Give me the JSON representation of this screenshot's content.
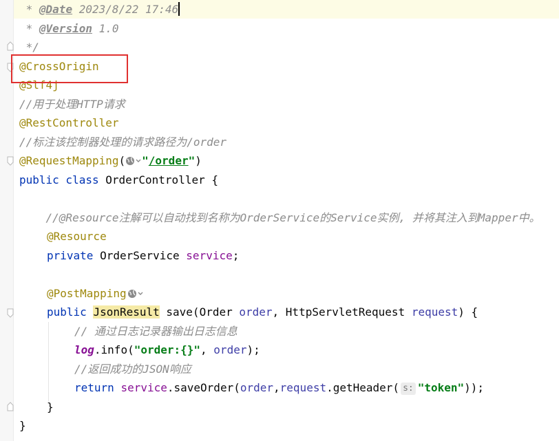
{
  "code": {
    "l1_prefix": " * ",
    "l1_tag": "@Date",
    "l1_rest": " 2023/8/22 17:46",
    "l2_prefix": " * ",
    "l2_tag": "@Version",
    "l2_rest": " 1.0",
    "l3": " */",
    "l4": "@CrossOrigin",
    "l5": "@Slf4j",
    "l6": "//用于处理HTTP请求",
    "l7": "@RestController",
    "l8": "//标注该控制器处理的请求路径为/order",
    "l9_ann": "@RequestMapping",
    "l9_open": "(",
    "l9_str_q1": "\"",
    "l9_str_path": "/order",
    "l9_str_q2": "\"",
    "l9_close": ")",
    "l10_kw": "public class",
    "l10_rest": " OrderController {",
    "l12": "    //@Resource注解可以自动找到名称为OrderService的Service实例, 并将其注入到Mapper中。",
    "l13": "@Resource",
    "l14_kw": "private",
    "l14_type": " OrderService ",
    "l14_field": "service",
    "l14_end": ";",
    "l16": "@PostMapping",
    "l17_kw": "public",
    "l17_ret": "JsonResult",
    "l17_a": " save(Order ",
    "l17_p1": "order",
    "l17_b": ", HttpServletRequest ",
    "l17_p2": "request",
    "l17_c": ") {",
    "l18": "// 通过日志记录器输出日志信息",
    "l19_log": "log",
    "l19_a": ".info(",
    "l19_str": "\"order:{}\"",
    "l19_b": ", ",
    "l19_p": "order",
    "l19_c": ");",
    "l20": "//返回成功的JSON响应",
    "l21_kw": "return",
    "l21_field": "service",
    "l21_a": ".saveOrder(",
    "l21_p1": "order",
    "l21_b": ",",
    "l21_p2": "request",
    "l21_c": ".getHeader(",
    "l21_hint": "s:",
    "l21_str": "\"token\"",
    "l21_d": "));",
    "l22": "}",
    "l23": "}"
  },
  "icons": {
    "globe": "globe-icon",
    "dropdown": "chevron-down-icon",
    "fold": "fold-marker-icon"
  },
  "colors": {
    "annotation": "#9e880d",
    "keyword": "#0033b3",
    "field": "#871094",
    "parameter": "#3d3da6",
    "string": "#067d17",
    "comment": "#8c8c8c",
    "highlight_box": "#e0302f"
  }
}
